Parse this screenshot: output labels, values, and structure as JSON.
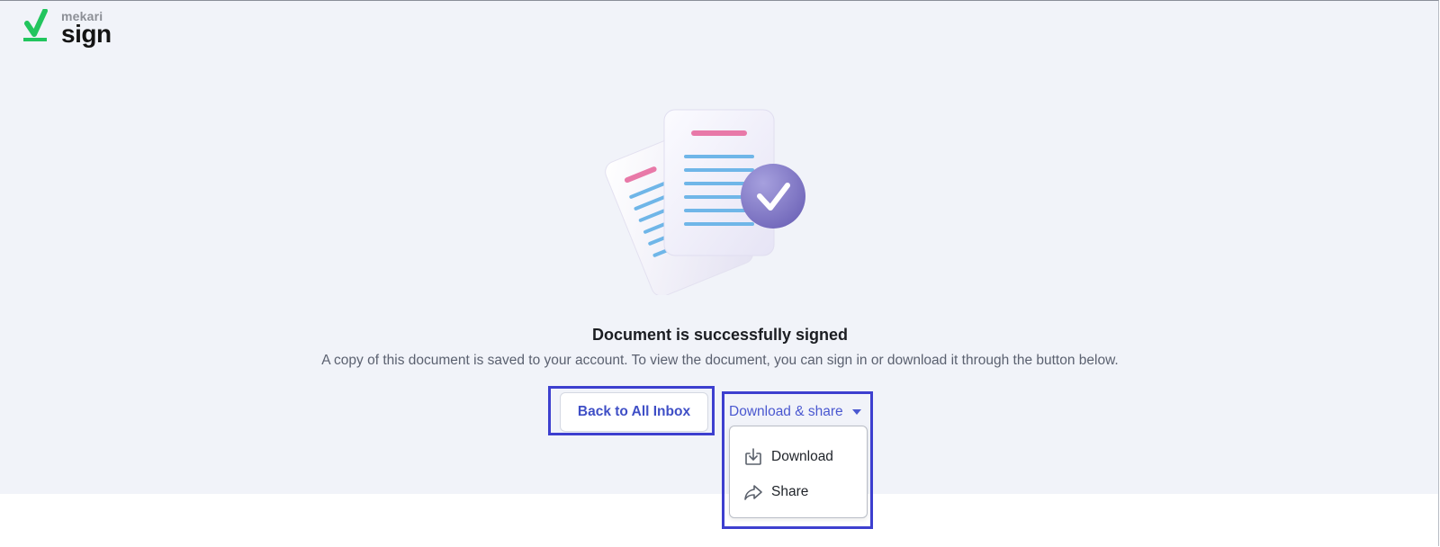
{
  "logo": {
    "top_text": "mekari",
    "main_text": "sign"
  },
  "main": {
    "title": "Document is successfully signed",
    "subtitle": "A copy of this document is saved to your account. To view the document, you can sign in or download it through the button below.",
    "back_button_label": "Back to All Inbox",
    "download_share_label": "Download & share"
  },
  "menu": {
    "items": [
      {
        "label": "Download",
        "icon": "download-icon"
      },
      {
        "label": "Share",
        "icon": "share-icon"
      }
    ]
  },
  "colors": {
    "accent": "#4a58d0",
    "highlight_box": "#3d3fcf",
    "logo_check": "#22c55e",
    "hero_background": "#f1f3f9"
  }
}
